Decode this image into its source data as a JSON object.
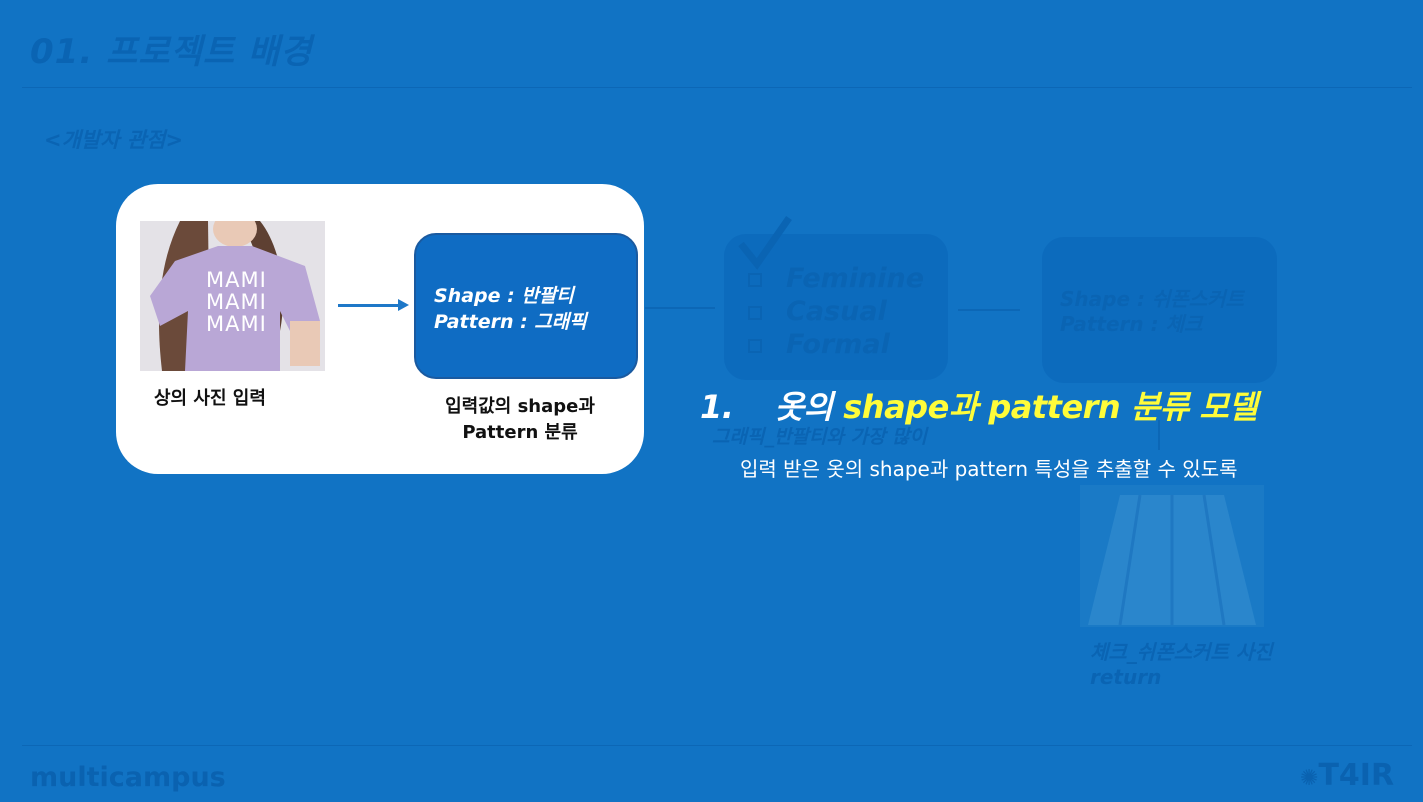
{
  "slide": {
    "title": "01. 프로젝트 배경",
    "subtitle": "<개발자 관점>",
    "logo_text": "multicampus",
    "corner_logo": "T4IR"
  },
  "card": {
    "photo_caption": "상의 사진 입력",
    "result_box": {
      "line1": "Shape : 반팔티",
      "line2": "Pattern : 그래픽"
    },
    "result_caption_line1": "입력값의 shape과",
    "result_caption_line2": "Pattern 분류"
  },
  "shirt_print": [
    "MAMI",
    "MAMI",
    "MAMI"
  ],
  "background_flow": {
    "style_options": [
      "Feminine",
      "Casual",
      "Formal"
    ],
    "match_box": {
      "line1": "Shape : 쉬폰스커트",
      "line2": "Pattern : 체크"
    },
    "mid_caption_line1": "그래픽_반팔티와 가장 많이",
    "return_caption_line1": "체크_쉬폰스커트 사진",
    "return_caption_line2": "return"
  },
  "highlight": {
    "number": "1.",
    "text_white": "옷의",
    "text_yellow": "shape과 pattern 분류 모델",
    "description": "입력 받은 옷의 shape과 pattern 특성을 추출할 수 있도록"
  },
  "colors": {
    "background": "#1173c4",
    "highlight_yellow": "#fffc3a",
    "box_blue": "#0f6cc3"
  }
}
